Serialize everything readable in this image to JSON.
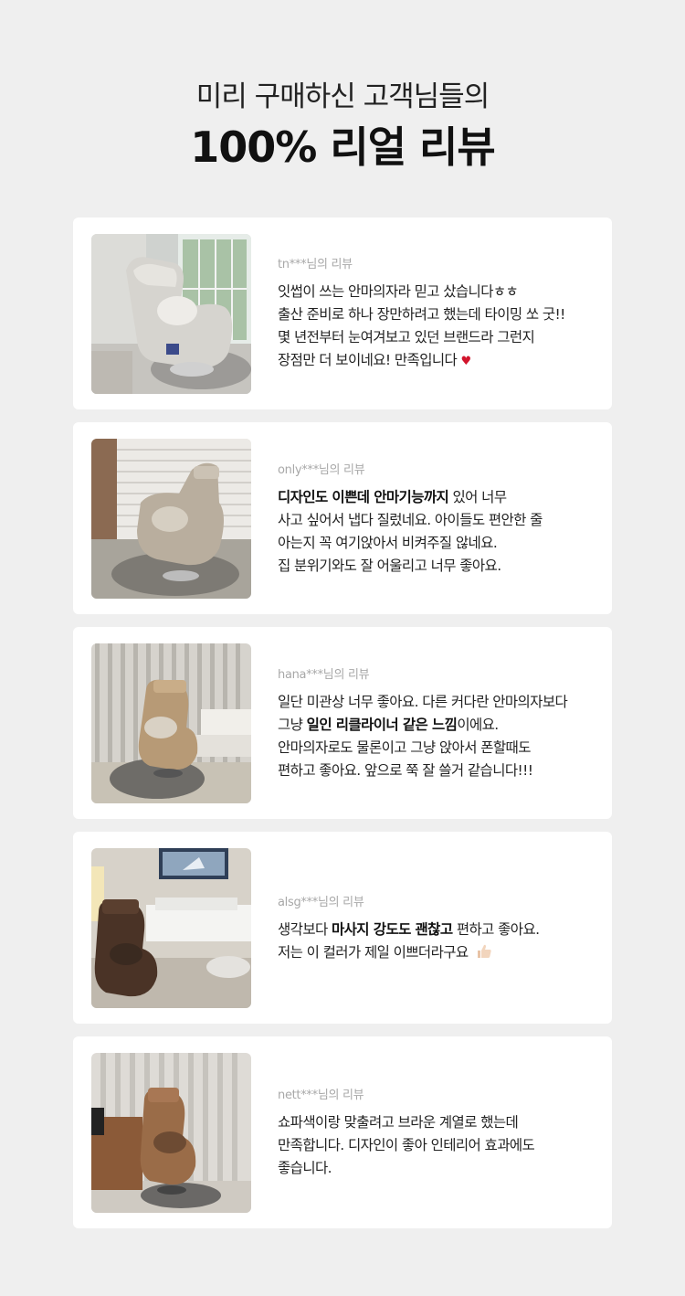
{
  "header": {
    "subtitle": "미리 구매하신 고객님들의",
    "title": "100% 리얼 리뷰"
  },
  "reviews": [
    {
      "reviewer": "tn***님의 리뷰",
      "photo": "gray massage chair by window with patio door",
      "lines": [
        [
          {
            "t": "잇썹이 쓰는 안마의자라 믿고 샀습니다ㅎㅎ"
          }
        ],
        [
          {
            "t": "출산 준비로 하나 장만하려고 했는데 타이밍 쏘 굿!!"
          }
        ],
        [
          {
            "t": "몇 년전부터 눈여겨보고 있던 브랜드라 그런지"
          }
        ],
        [
          {
            "t": "장점만 더 보이네요! 만족입니다 "
          },
          {
            "t": "♥",
            "emoji": "heart"
          }
        ]
      ]
    },
    {
      "reviewer": "only***님의 리뷰",
      "photo": "beige massage chair in front of shutters",
      "lines": [
        [
          {
            "t": "디자인도 이쁜데 안마기능까지",
            "bold": true
          },
          {
            "t": " 있어 너무"
          }
        ],
        [
          {
            "t": "사고 싶어서 냅다 질렀네요. 아이들도 편안한 줄"
          }
        ],
        [
          {
            "t": "아는지 꼭 여기앉아서 비켜주질 않네요."
          }
        ],
        [
          {
            "t": "집 분위기와도 잘 어울리고 너무 좋아요."
          }
        ]
      ]
    },
    {
      "reviewer": "hana***님의 리뷰",
      "photo": "tan massage chair beside white sofa and curtains",
      "lines": [
        [
          {
            "t": "일단 미관상 너무 좋아요. 다른 커다란 안마의자보다"
          }
        ],
        [
          {
            "t": "그냥 "
          },
          {
            "t": "일인 리클라이너 같은 느낌",
            "bold": true
          },
          {
            "t": "이에요."
          }
        ],
        [
          {
            "t": "안마의자로도 물론이고 그냥 앉아서 폰할때도"
          }
        ],
        [
          {
            "t": "편하고 좋아요. 앞으로 쭉 잘 쓸거 같습니다!!!"
          }
        ]
      ]
    },
    {
      "reviewer": "alsg***님의 리뷰",
      "photo": "brown massage chair in living room with whale painting",
      "lines": [
        [
          {
            "t": "생각보다 "
          },
          {
            "t": "마사지 강도도 괜찮고",
            "bold": true
          },
          {
            "t": " 편하고 좋아요."
          }
        ],
        [
          {
            "t": "저는 이 컬러가 제일 이쁘더라구요 "
          },
          {
            "t": "",
            "emoji": "thumbs-up"
          }
        ]
      ]
    },
    {
      "reviewer": "nett***님의 리뷰",
      "photo": "brown massage chair next to brown leather sofa",
      "lines": [
        [
          {
            "t": "쇼파색이랑 맞출려고 브라운 계열로 했는데"
          }
        ],
        [
          {
            "t": "만족합니다. 디자인이 좋아 인테리어 효과에도"
          }
        ],
        [
          {
            "t": "좋습니다."
          }
        ]
      ]
    }
  ]
}
